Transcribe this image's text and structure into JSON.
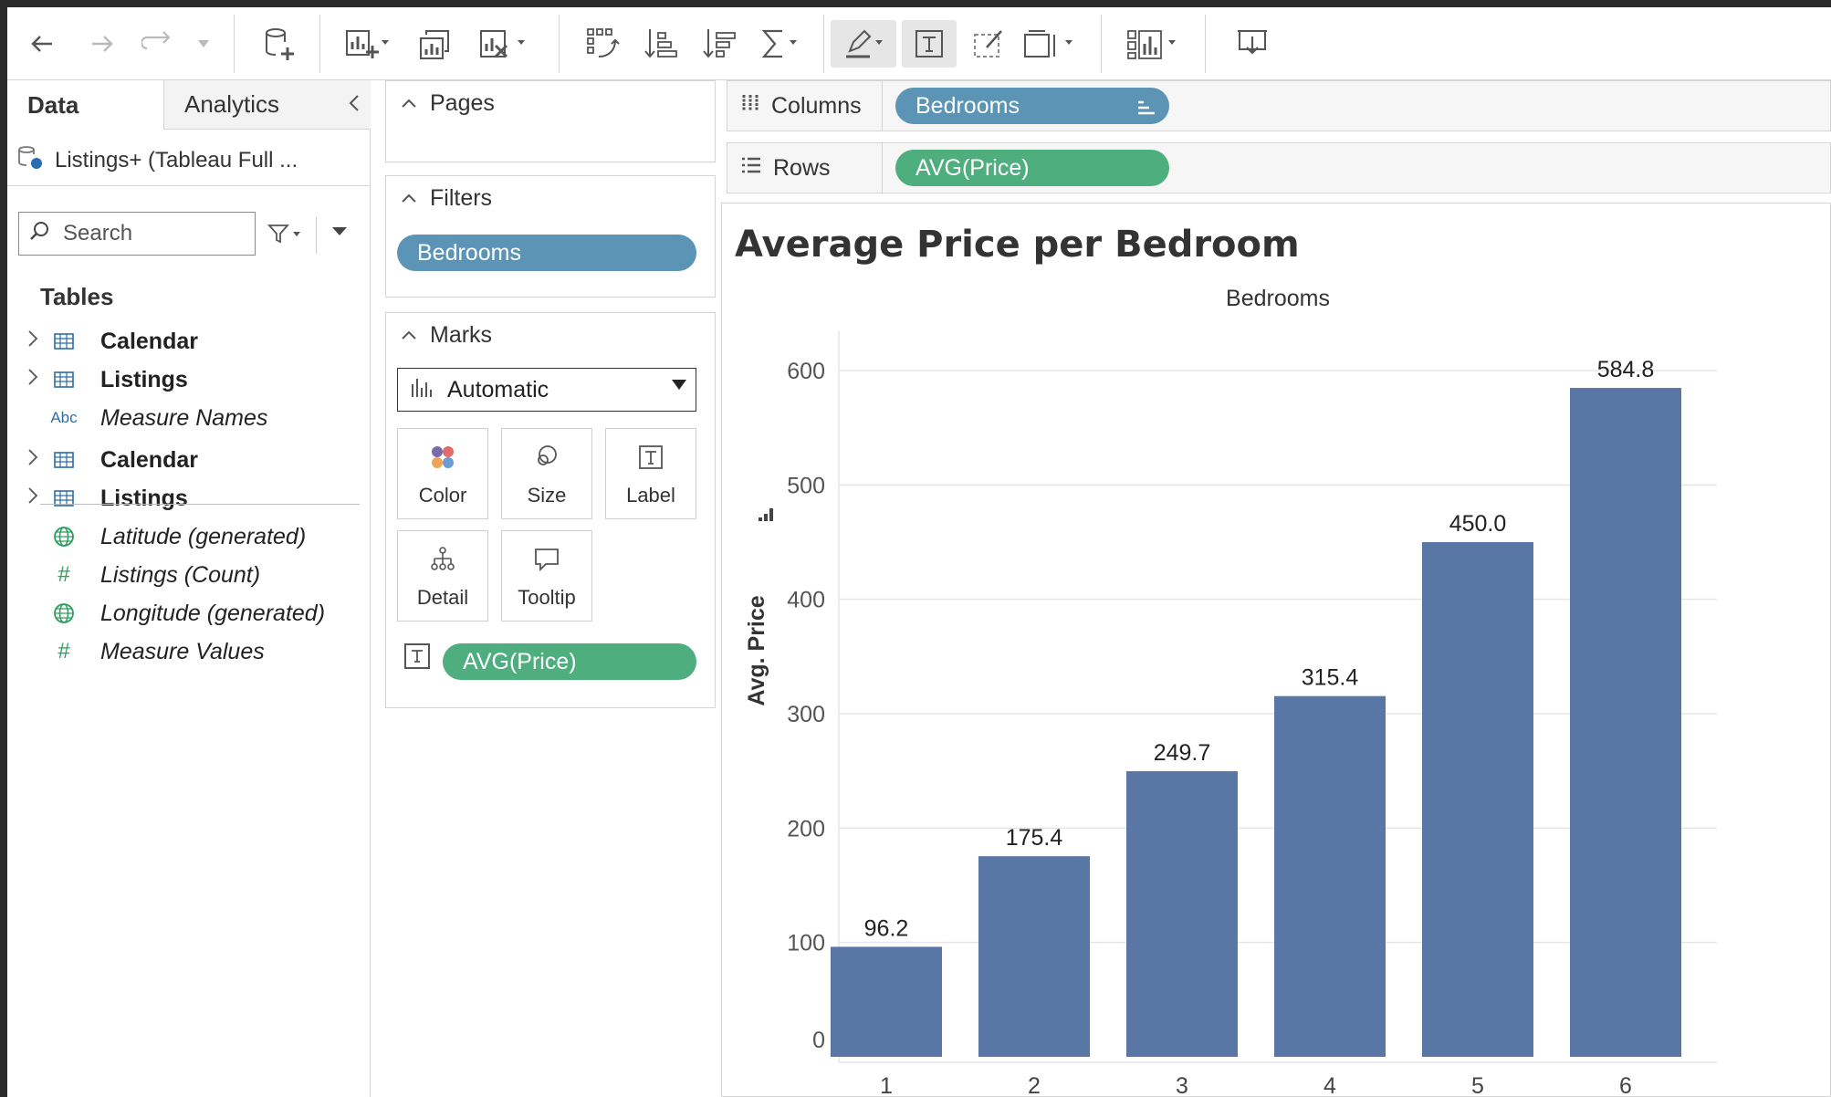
{
  "toolbar": {
    "icons": [
      "back-arrow-icon",
      "forward-arrow-icon",
      "redo-icon",
      "dropdown-icon",
      "new-datasource-icon",
      "new-worksheet-icon",
      "duplicate-sheet-icon",
      "clear-sheet-icon",
      "swap-rows-columns-icon",
      "sort-ascending-icon",
      "sort-descending-icon",
      "totals-icon",
      "highlight-icon",
      "text-label-icon",
      "annotate-icon",
      "fit-icon",
      "show-me-icon",
      "presentation-icon"
    ]
  },
  "data_pane": {
    "tab_data": "Data",
    "tab_analytics": "Analytics",
    "datasource": "Listings+ (Tableau Full ...",
    "search_placeholder": "Search",
    "tables_heading": "Tables",
    "fields": [
      {
        "label": "Calendar",
        "style": "bold",
        "icon": "table-icon",
        "expandable": true
      },
      {
        "label": "Listings",
        "style": "bold",
        "icon": "table-icon",
        "expandable": true
      },
      {
        "label": "Measure Names",
        "style": "italic",
        "icon": "abc-icon",
        "icon_text": "Abc",
        "expandable": false
      },
      {
        "label": "Calendar",
        "style": "bold",
        "icon": "table-icon",
        "expandable": true
      },
      {
        "label": "Listings",
        "style": "bold",
        "icon": "table-icon",
        "expandable": true
      },
      {
        "label": "Latitude (generated)",
        "style": "italic",
        "icon": "globe-icon",
        "expandable": false
      },
      {
        "label": "Listings (Count)",
        "style": "italic",
        "icon": "hash-icon",
        "icon_text": "#",
        "expandable": false
      },
      {
        "label": "Longitude (generated)",
        "style": "italic",
        "icon": "globe-icon",
        "expandable": false
      },
      {
        "label": "Measure Values",
        "style": "italic",
        "icon": "hash-icon",
        "icon_text": "#",
        "expandable": false
      }
    ]
  },
  "cards": {
    "pages_title": "Pages",
    "filters_title": "Filters",
    "filter_pill": "Bedrooms",
    "marks_title": "Marks",
    "mark_type": "Automatic",
    "mark_buttons": [
      "Color",
      "Size",
      "Label",
      "Detail",
      "Tooltip"
    ],
    "label_pill": "AVG(Price)"
  },
  "shelves": {
    "columns_label": "Columns",
    "columns_pill": "Bedrooms",
    "rows_label": "Rows",
    "rows_pill": "AVG(Price)"
  },
  "colors": {
    "bar": "#5877a5",
    "pill_blue": "#5b94b5",
    "pill_green": "#4eae7e"
  },
  "chart_data": {
    "type": "bar",
    "title": "Average Price per Bedroom",
    "xlabel": "Bedrooms",
    "ylabel": "Avg. Price",
    "categories": [
      "1",
      "2",
      "3",
      "4",
      "5",
      "6"
    ],
    "values": [
      96.2,
      175.4,
      249.7,
      315.4,
      450.0,
      584.8
    ],
    "value_labels": [
      "96.2",
      "175.4",
      "249.7",
      "315.4",
      "450.0",
      "584.8"
    ],
    "yticks": [
      "0",
      "100",
      "200",
      "300",
      "400",
      "500",
      "600"
    ],
    "ylim": [
      0,
      600
    ],
    "grid": true,
    "legend": "none"
  }
}
